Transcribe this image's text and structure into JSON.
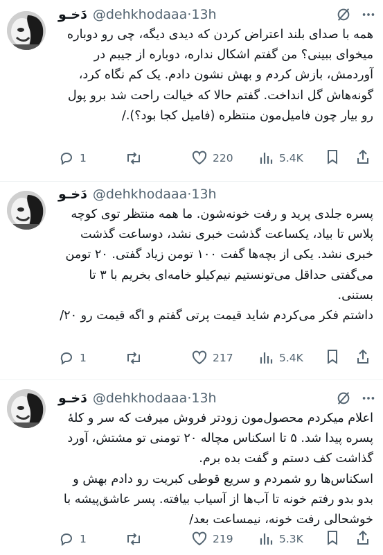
{
  "tweets": [
    {
      "name": "دَخـو",
      "handle": "@dehkhodaaa",
      "time": "13h",
      "text": "همه با صدای بلند اعتراض کردن که دیدی دیگه، چی رو دوباره میخوای ببینی؟ من گفتم اشکال نداره، دوباره از جیبم در آوردمش، بازش کردم و بهش نشون دادم. یک کم نگاه کرد، گونه‌هاش گل انداخت. گفتم حالا که خیالت راحت شد برو پول رو بیار چون فامیل‌مون منتظره (فامیل کجا بود؟)./",
      "replies": "1",
      "retweets": "",
      "likes": "220",
      "views": "5.4K"
    },
    {
      "name": "دَخـو",
      "handle": "@dehkhodaaa",
      "time": "13h",
      "text": "پسره جلدی پرید و رفت خونه‌شون. ما همه منتظر توی کوچه پلاس تا بیاد، یکساعت گذشت خبری نشد، دوساعت گذشت خبری نشد. یکی از بچه‌ها گفت ۱۰۰ تومن زیاد گفتی. ۲۰ تومن می‌گفتی حداقل می‌تونستیم نیم‌کیلو خامه‌ای بخریم با ۳ تا بستنی.\nداشتم فکر می‌کردم شاید قیمت پرتی گفتم و اگه قیمت رو ۲۰/",
      "replies": "1",
      "retweets": "",
      "likes": "217",
      "views": "5.4K"
    },
    {
      "name": "دَخـو",
      "handle": "@dehkhodaaa",
      "time": "13h",
      "text": "اعلام میکردم محصول‌مون زودتر فروش میرفت که سر و کلهٔ پسره پیدا شد. ۵ تا اسکناس مچاله ۲۰ تومنی تو مشتش، آورد گذاشت کف دستم و گفت بده برم.\nاسکناس‌ها رو شمردم و سریع قوطی کبریت رو دادم بهش و بدو بدو رفتم خونه تا آب‌ها از آسیاب بیافته. پسر عاشق‌پیشه با خوشحالی رفت خونه، نیمساعت بعد/",
      "replies": "1",
      "retweets": "",
      "likes": "219",
      "views": "5.3K"
    }
  ],
  "colors": {
    "text": "#0f1419",
    "secondary": "#536471",
    "divider": "#eff3f4"
  },
  "icons": [
    "grok-icon",
    "more-icon",
    "reply-icon",
    "retweet-icon",
    "like-icon",
    "views-icon",
    "bookmark-icon",
    "share-icon"
  ]
}
